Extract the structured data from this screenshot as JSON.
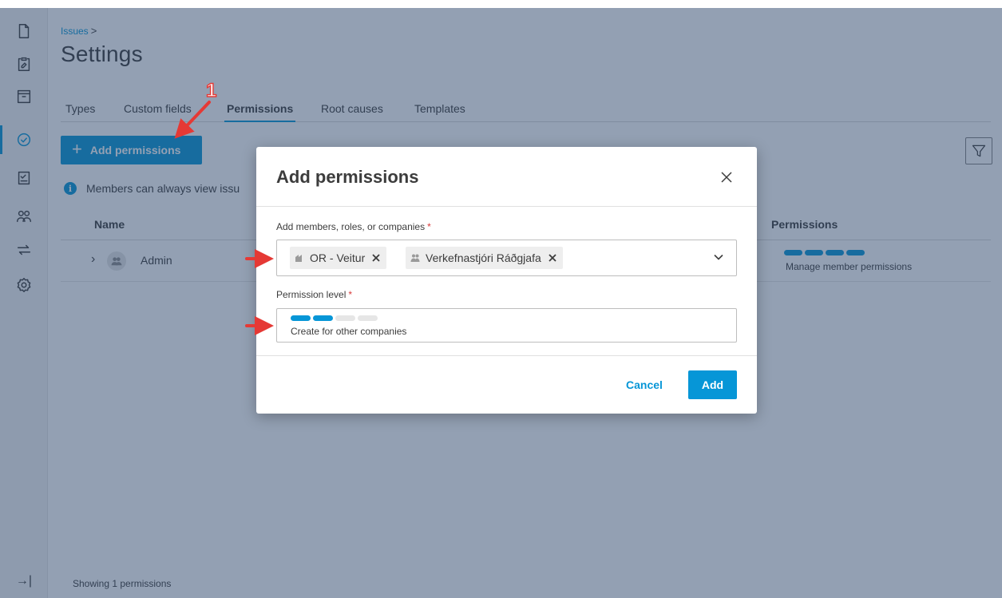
{
  "breadcrumb": {
    "parent": "Issues",
    "separator": ">"
  },
  "page": {
    "title": "Settings"
  },
  "tabs": [
    {
      "label": "Types"
    },
    {
      "label": "Custom fields"
    },
    {
      "label": "Permissions"
    },
    {
      "label": "Root causes"
    },
    {
      "label": "Templates"
    }
  ],
  "toolbar": {
    "add_permissions_label": "Add permissions",
    "add_icon": "+"
  },
  "info": {
    "text": "Members can always view issu"
  },
  "table": {
    "columns": {
      "name": "Name",
      "permissions": "Permissions"
    },
    "rows": [
      {
        "name": "Admin",
        "permission_label": "Manage member permissions",
        "permission_level": 4,
        "permission_max": 4
      }
    ]
  },
  "footer": {
    "status": "Showing 1 permissions",
    "collapse_icon": "→|"
  },
  "rail_icons": [
    "document-icon",
    "clipboard-icon",
    "archive-icon",
    "check-circle-icon",
    "checklist-icon",
    "people-icon",
    "swap-arrows-icon",
    "gear-icon"
  ],
  "dialog": {
    "title": "Add permissions",
    "members_label": "Add members, roles, or companies",
    "required_mark": "*",
    "selected": [
      {
        "label": "OR - Veitur",
        "kind": "company"
      },
      {
        "label": "Verkefnastjóri Ráðgjafa",
        "kind": "role"
      }
    ],
    "level_label": "Permission level",
    "level": {
      "label": "Create for other companies",
      "value": 2,
      "max": 4
    },
    "cancel_label": "Cancel",
    "add_label": "Add"
  },
  "annotation": {
    "step_number": "1"
  },
  "colors": {
    "accent": "#0696d7",
    "annotation": "#e53935",
    "required": "#d83939"
  }
}
